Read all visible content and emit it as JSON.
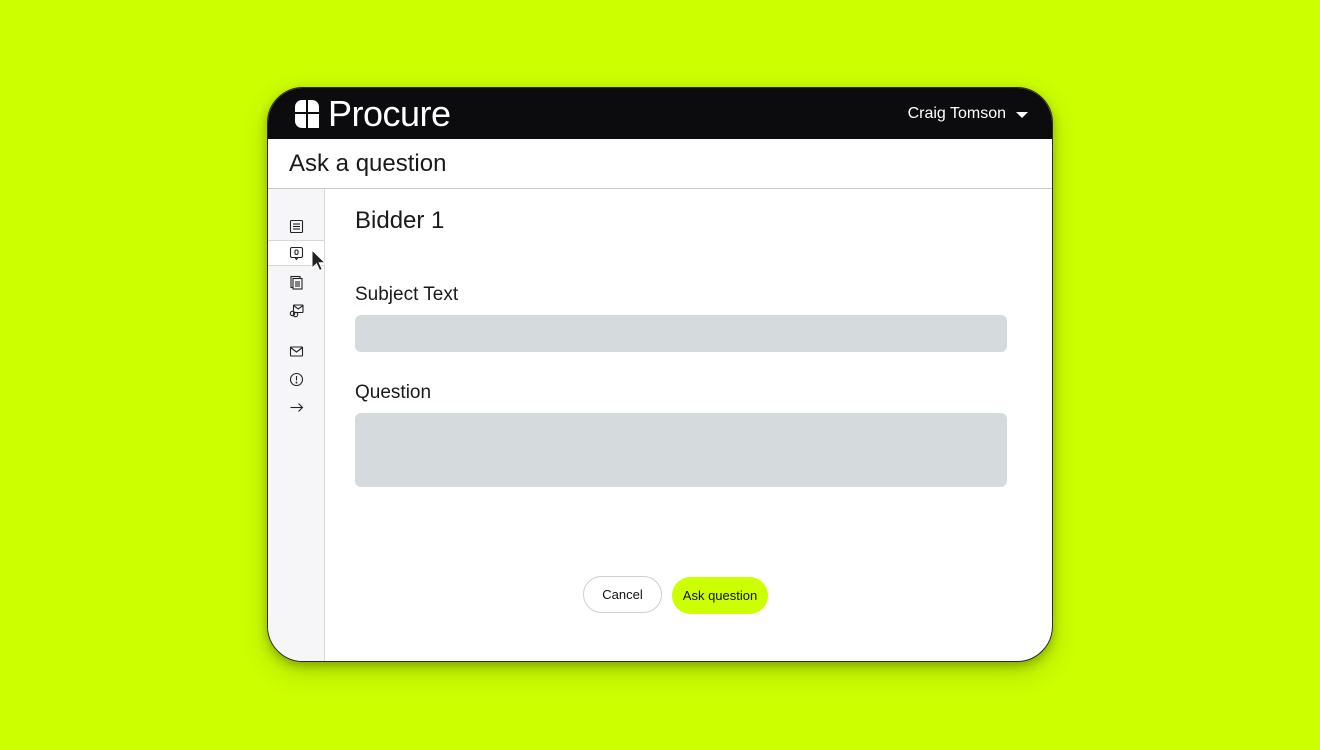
{
  "app": {
    "brand": "Procure"
  },
  "user": {
    "name": "Craig Tomson"
  },
  "page": {
    "title": "Ask a question"
  },
  "sidebar": {
    "items": [
      {
        "icon": "list-icon",
        "active": false
      },
      {
        "icon": "question-box-icon",
        "active": true
      },
      {
        "icon": "documents-icon",
        "active": false
      },
      {
        "icon": "mail-link-icon",
        "active": false
      },
      {
        "icon": "mail-icon",
        "active": false
      },
      {
        "icon": "alert-circle-icon",
        "active": false
      },
      {
        "icon": "arrow-right-icon",
        "active": false
      }
    ]
  },
  "form": {
    "bidder": "Bidder 1",
    "subject_label": "Subject Text",
    "subject_value": "",
    "question_label": "Question",
    "question_value": "",
    "cancel_label": "Cancel",
    "submit_label": "Ask question"
  },
  "colors": {
    "accent": "#ccff00",
    "topbar": "#0c0c0e",
    "field": "#d5dbdc"
  }
}
